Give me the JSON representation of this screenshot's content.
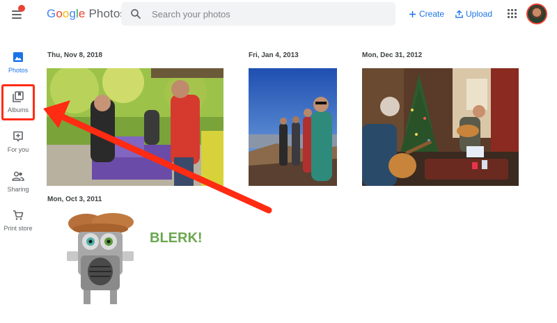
{
  "header": {
    "logo_letters": [
      "G",
      "o",
      "o",
      "g",
      "l",
      "e"
    ],
    "logo_product": "Photos",
    "search": {
      "placeholder": "Search your photos"
    },
    "create_label": "Create",
    "upload_label": "Upload",
    "icons": [
      "hamburger-menu-icon",
      "search-icon",
      "plus-icon",
      "upload-icon",
      "apps-grid-icon"
    ]
  },
  "sidebar": {
    "items": [
      {
        "label": "Photos",
        "icon": "photo-icon",
        "active": true
      },
      {
        "label": "Albums",
        "icon": "albums-icon",
        "active": false
      },
      {
        "label": "For you",
        "icon": "assistant-icon",
        "active": false
      },
      {
        "label": "Sharing",
        "icon": "people-icon",
        "active": false
      },
      {
        "label": "Print store",
        "icon": "shopping-cart-icon",
        "active": false
      }
    ]
  },
  "groups": [
    {
      "date": "Thu, Nov 8, 2018",
      "photo": "Outdoor craft table with people and purple bags"
    },
    {
      "date": "Fri, Jan 4, 2013",
      "photo": "Hikers on a desert ridge under blue sky"
    },
    {
      "date": "Mon, Dec 31, 2012",
      "photo": "Living room with Christmas tree and guitar players"
    },
    {
      "date": "Mon, Oct 3, 2011",
      "photo": "Tin can robot sculpture",
      "caption": "BLERK!"
    }
  ],
  "colors": {
    "accent": "#1a73e8",
    "annotation": "#ff2b12",
    "notification": "#ea4335",
    "caption": "#6aa84f"
  }
}
